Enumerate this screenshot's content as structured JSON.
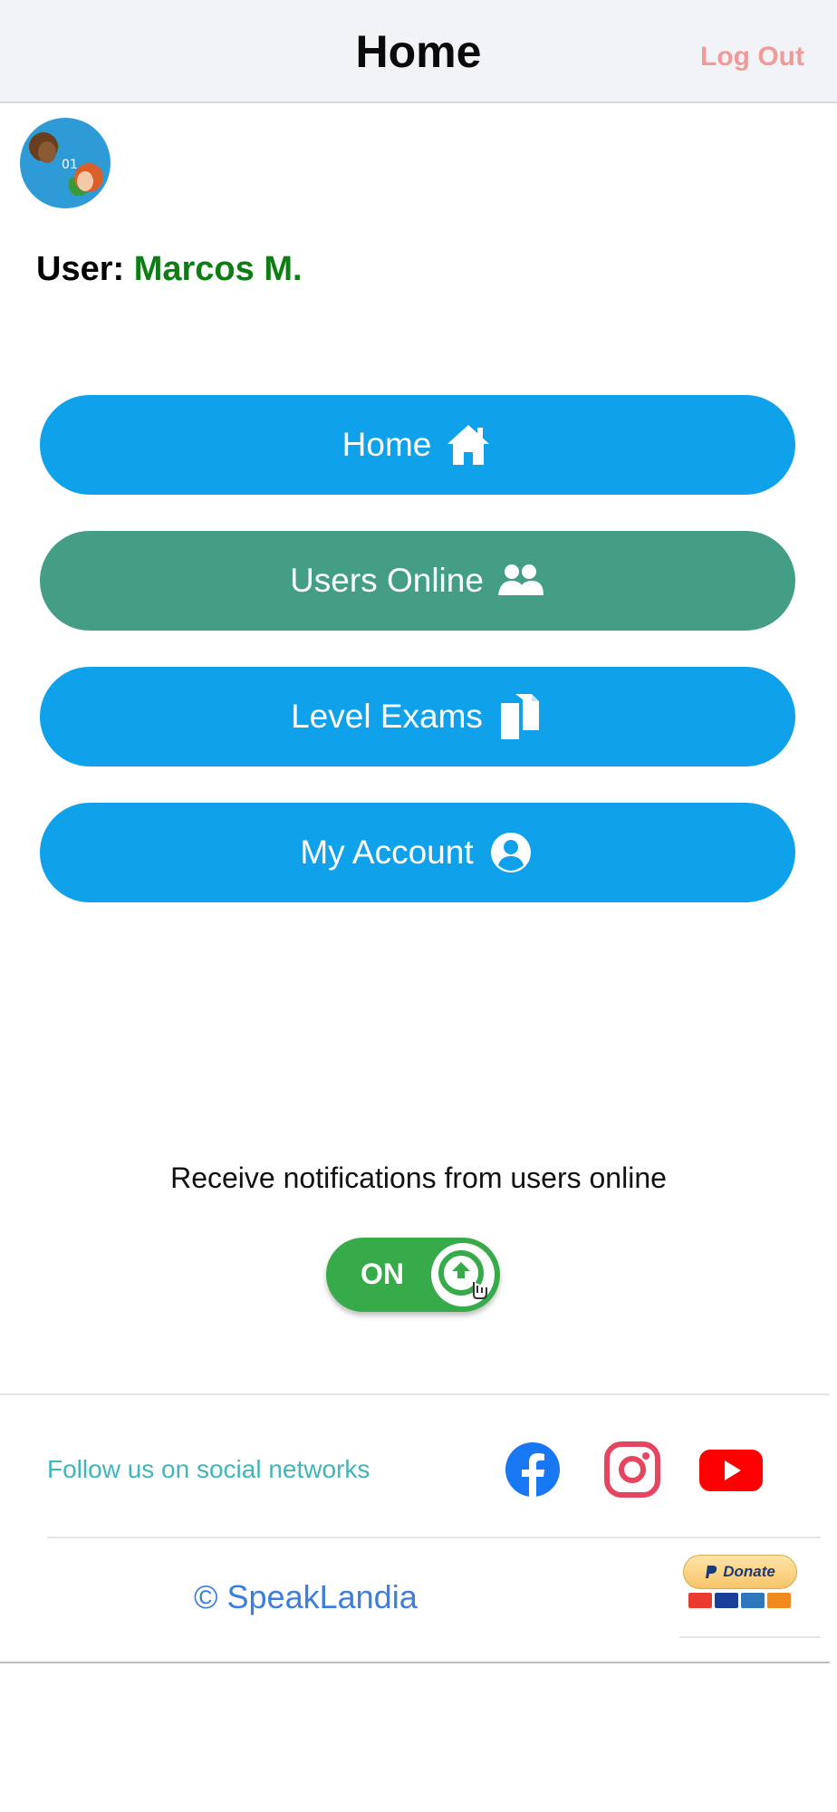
{
  "header": {
    "title": "Home",
    "logout_label": "Log Out"
  },
  "user": {
    "label": "User:",
    "name": "Marcos M."
  },
  "menu": [
    {
      "label": "Home",
      "icon": "home-icon",
      "color": "#0fa1ea"
    },
    {
      "label": "Users Online",
      "icon": "users-icon",
      "color": "#449e86"
    },
    {
      "label": "Level Exams",
      "icon": "documents-icon",
      "color": "#0fa1ea"
    },
    {
      "label": "My Account",
      "icon": "user-circle-icon",
      "color": "#0fa1ea"
    }
  ],
  "notifications": {
    "label": "Receive notifications from users online",
    "toggle_label": "ON",
    "enabled": true
  },
  "footer": {
    "follow_label": "Follow us on social networks",
    "social": [
      "facebook-icon",
      "instagram-icon",
      "youtube-icon"
    ],
    "copyright": "© SpeakLandia",
    "donate_label": "Donate"
  },
  "colors": {
    "accent_blue": "#0fa1ea",
    "accent_green": "#449e86",
    "user_name": "#0d7d14",
    "logout": "#f19a9a",
    "toggle_on": "#37ab4a"
  }
}
